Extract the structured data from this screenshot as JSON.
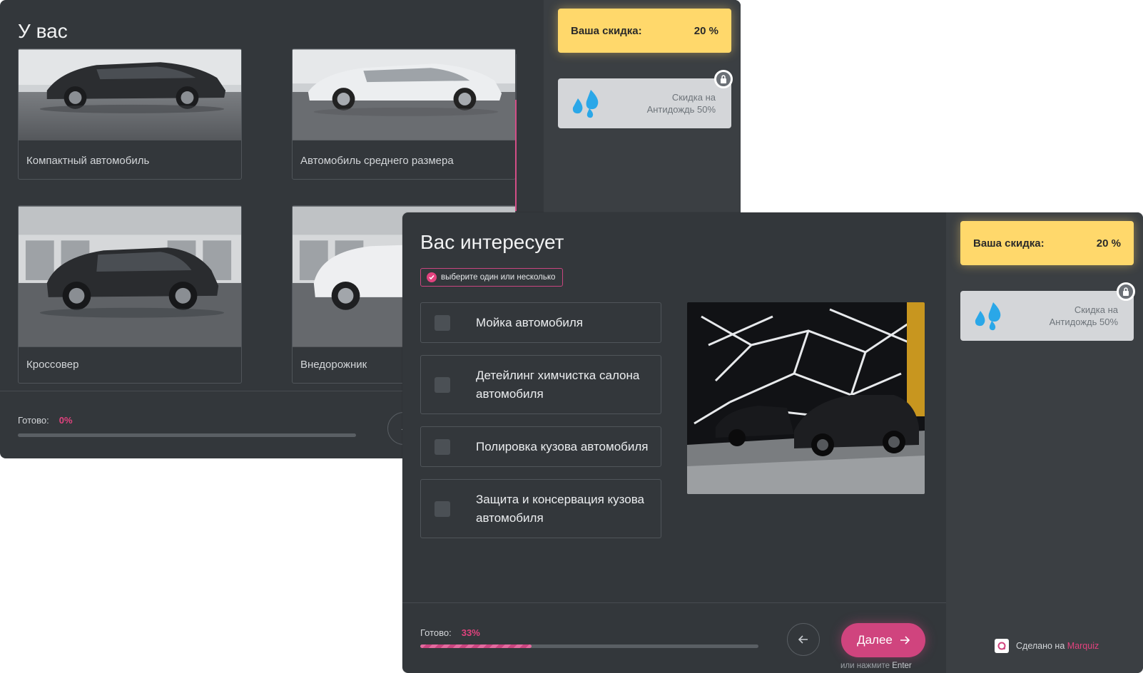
{
  "back_quiz": {
    "title": "У вас",
    "cards": [
      {
        "label": "Компактный автомобиль"
      },
      {
        "label": "Автомобиль среднего размера"
      },
      {
        "label": "Кроссовер"
      },
      {
        "label": "Внедорожник"
      }
    ],
    "progress": {
      "label": "Готово:",
      "value": "0%",
      "fraction": 0.0
    },
    "sidebar": {
      "discount_label": "Ваша скидка:",
      "discount_value": "20 %",
      "bonus_text_1": "Скидка на",
      "bonus_text_2": "Антидождь 50%"
    }
  },
  "front_quiz": {
    "title": "Вас интересует",
    "hint": "выберите один или несколько",
    "options": [
      {
        "text": "Мойка автомобиля"
      },
      {
        "text": "Детейлинг химчистка салона автомобиля"
      },
      {
        "text": "Полировка кузова автомобиля"
      },
      {
        "text": "Защита и консервация кузова автомобиля"
      }
    ],
    "progress": {
      "label": "Готово:",
      "value": "33%",
      "fraction": 0.33
    },
    "next_label": "Далее",
    "enter_hint_prefix": "или нажмите",
    "enter_hint_key": "Enter",
    "sidebar": {
      "discount_label": "Ваша скидка:",
      "discount_value": "20 %",
      "bonus_text_1": "Скидка на",
      "bonus_text_2": "Антидождь 50%",
      "made_prefix": "Сделано на",
      "made_brand": "Marquiz"
    }
  },
  "colors": {
    "panel": "#33373b",
    "sidebar": "#3b3f43",
    "accent": "#d0447e",
    "discount": "#ffd86b"
  },
  "icons": [
    "water-drops-icon",
    "lock-icon",
    "check-icon",
    "arrow-left-icon",
    "arrow-right-icon",
    "marquiz-logo-icon"
  ]
}
